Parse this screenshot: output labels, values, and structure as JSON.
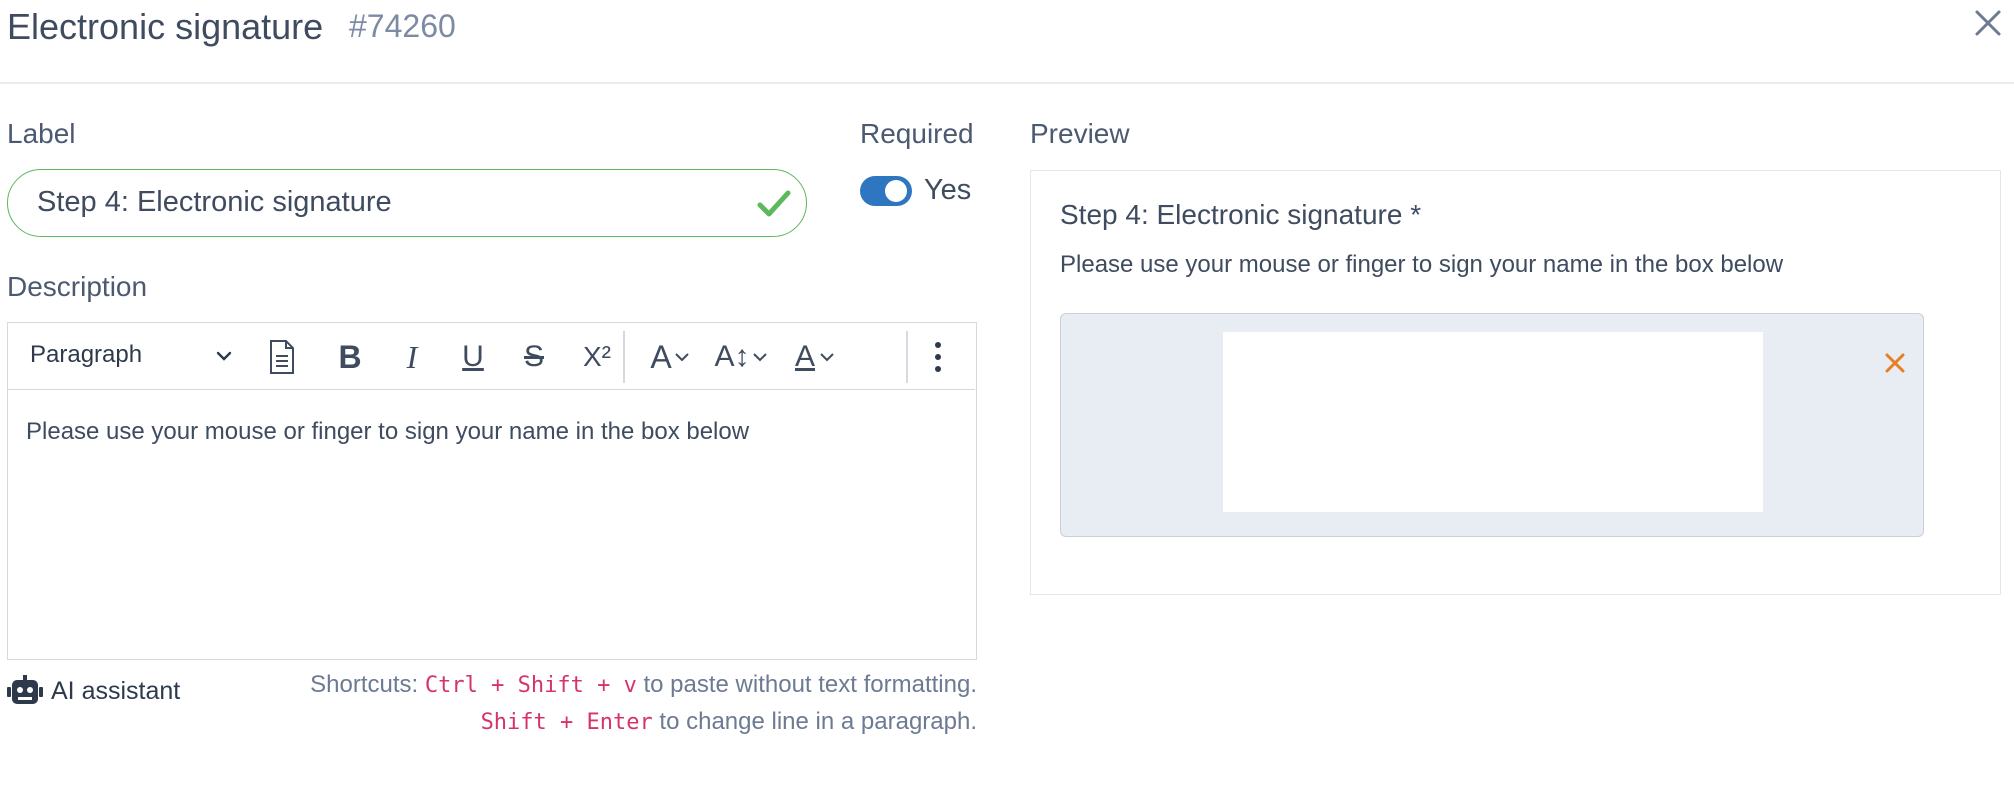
{
  "header": {
    "title": "Electronic signature",
    "id": "#74260",
    "close_icon": "close-icon"
  },
  "form": {
    "label_heading": "Label",
    "label_value": "Step 4: Electronic signature",
    "required_heading": "Required",
    "required_toggle_text": "Yes",
    "required_on": true,
    "description_heading": "Description"
  },
  "editor": {
    "paragraph_select": "Paragraph",
    "toolbar_icons": [
      "document-icon",
      "bold-icon",
      "italic-icon",
      "underline-icon",
      "strikethrough-icon",
      "superscript-icon",
      "font-family-icon",
      "font-size-icon",
      "font-color-icon",
      "more-options-icon"
    ],
    "bold_glyph": "B",
    "italic_glyph": "I",
    "underline_glyph": "U",
    "strike_glyph": "S",
    "superscript_glyph": "X²",
    "font_family_glyph": "A",
    "font_size_glyph": "A↕",
    "font_color_glyph": "A",
    "body_text": "Please use your mouse or finger to sign your name in the box below"
  },
  "footer": {
    "ai_label": "AI assistant",
    "shortcut_prefix": "Shortcuts:",
    "shortcut1_keys": "Ctrl + Shift + v",
    "shortcut1_text": "to paste without text formatting.",
    "shortcut2_keys": "Shift + Enter",
    "shortcut2_text": "to change line in a paragraph."
  },
  "preview": {
    "heading": "Preview",
    "field_title": "Step 4: Electronic signature *",
    "field_desc": "Please use your mouse or finger to sign your name in the box below"
  },
  "colors": {
    "accent": "#2f76c0",
    "valid": "#5cb85c",
    "clear": "#e67e22",
    "code": "#d6336c"
  }
}
